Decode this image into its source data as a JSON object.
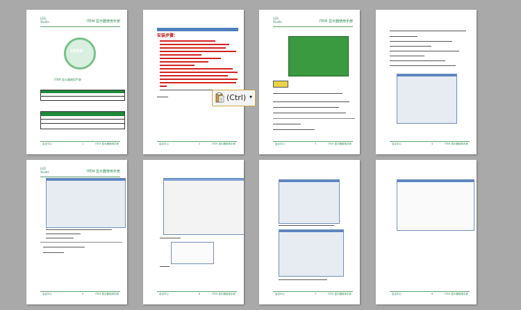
{
  "document": {
    "header_logo": "LED\nStudio",
    "header_title": "ITEM 显示器使用手册",
    "footer_left": "会议中心",
    "footer_right": "ITEM 显示器使用手册"
  },
  "cover": {
    "logo_text": "LOGO",
    "title": "ITEM 显示器使用手册"
  },
  "page2": {
    "heading": "安装步骤："
  },
  "paste_tag": {
    "label": "(Ctrl)",
    "arrow": "▾"
  },
  "pages": [
    {
      "number": "1"
    },
    {
      "number": "2"
    },
    {
      "number": "3"
    },
    {
      "number": "4"
    },
    {
      "number": "5"
    },
    {
      "number": "6"
    },
    {
      "number": "7"
    },
    {
      "number": "8"
    }
  ]
}
